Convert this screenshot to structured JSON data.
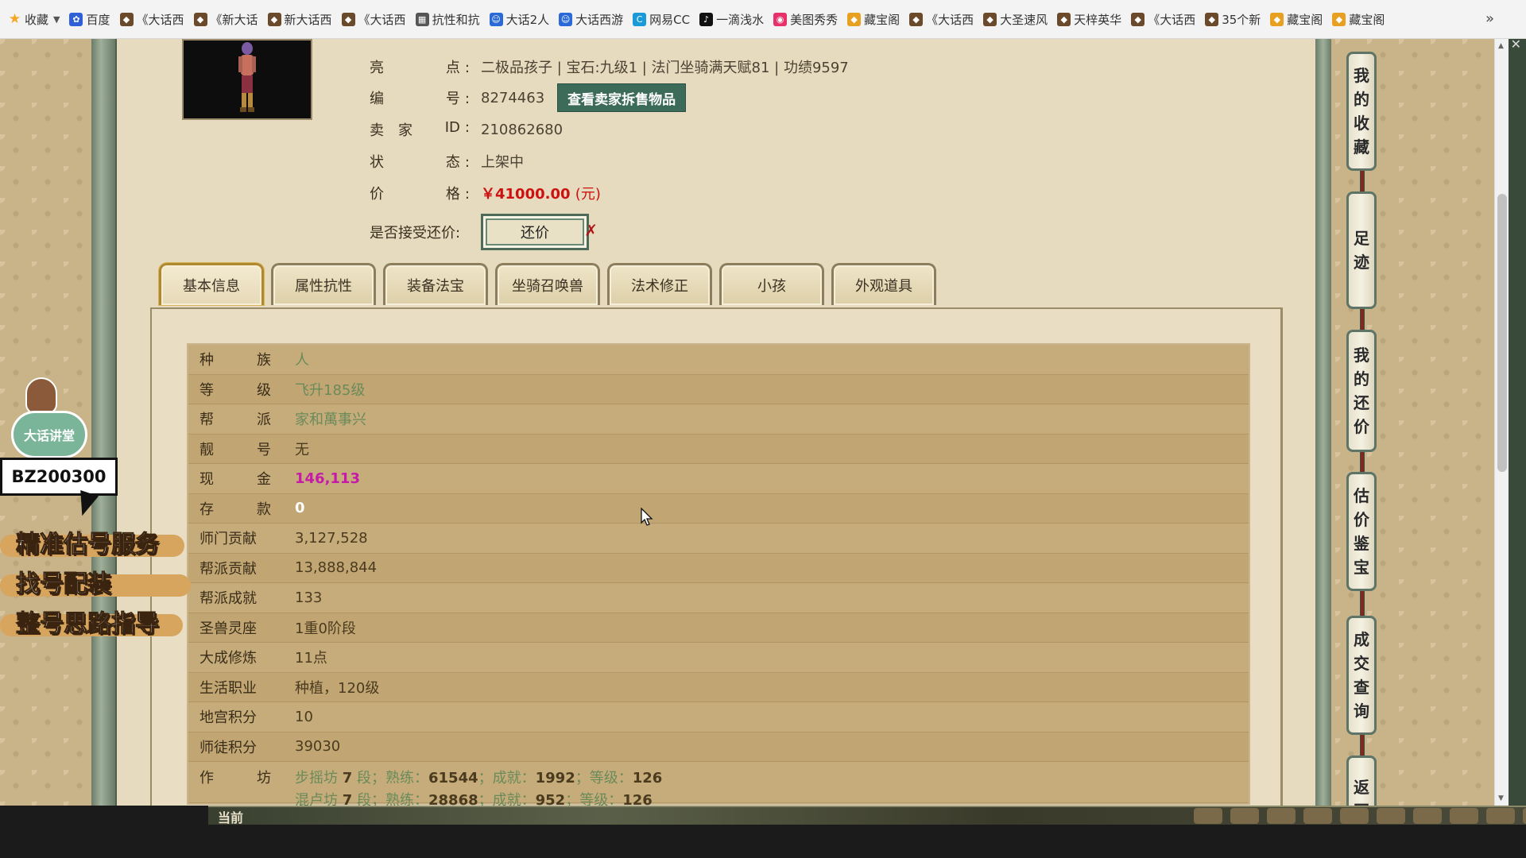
{
  "bookmarks": {
    "items": [
      {
        "label": "收藏",
        "icon": "star-icon",
        "color": "#f5a623",
        "dropdown": true
      },
      {
        "label": "百度",
        "icon": "baidu-icon",
        "color": "#3060d8"
      },
      {
        "label": "《大话西",
        "icon": "game-icon",
        "color": "#6a4a2a"
      },
      {
        "label": "《新大话",
        "icon": "game-icon",
        "color": "#6a4a2a"
      },
      {
        "label": "新大话西",
        "icon": "game-icon",
        "color": "#6a4a2a"
      },
      {
        "label": "《大话西",
        "icon": "game-icon",
        "color": "#6a4a2a"
      },
      {
        "label": "抗性和抗",
        "icon": "page-icon",
        "color": "#555555"
      },
      {
        "label": "大话2人",
        "icon": "mascot-icon",
        "color": "#2a6ad8"
      },
      {
        "label": "大话西游",
        "icon": "mascot-icon",
        "color": "#2a6ad8"
      },
      {
        "label": "网易CC",
        "icon": "cc-icon",
        "color": "#1a9ad8"
      },
      {
        "label": "一滴浅水",
        "icon": "tiktok-icon",
        "color": "#111111"
      },
      {
        "label": "美图秀秀",
        "icon": "meitu-icon",
        "color": "#e8306a"
      },
      {
        "label": "藏宝阁",
        "icon": "treasure-icon",
        "color": "#e8a020"
      },
      {
        "label": "《大话西",
        "icon": "game-icon",
        "color": "#6a4a2a"
      },
      {
        "label": "大圣速风",
        "icon": "game-icon",
        "color": "#6a4a2a"
      },
      {
        "label": "天梓英华",
        "icon": "game-icon",
        "color": "#6a4a2a"
      },
      {
        "label": "《大话西",
        "icon": "game-icon",
        "color": "#6a4a2a"
      },
      {
        "label": "35个新",
        "icon": "game-icon",
        "color": "#6a4a2a"
      },
      {
        "label": "藏宝阁",
        "icon": "treasure-icon",
        "color": "#e8a020"
      },
      {
        "label": "藏宝阁",
        "icon": "treasure-icon",
        "color": "#e8a020"
      }
    ],
    "more": "»"
  },
  "item_info": {
    "highlights_label": "亮",
    "highlights_label2": "点",
    "highlights": "二极品孩子 | 宝石:九级1 | 法门坐骑满天赋81 | 功绩9597",
    "id_label": "编",
    "id_label2": "号",
    "id_value": "8274463",
    "seller_button": "查看卖家拆售物品",
    "seller_label": "卖　家",
    "seller_label2": "ID",
    "seller_id": "210862680",
    "status_label": "状",
    "status_label2": "态",
    "status": "上架中",
    "price_label": "价",
    "price_label2": "格",
    "price": "￥41000.00",
    "price_unit": "(元)",
    "bargain_label": "是否接受还价:",
    "bargain_button": "还价",
    "bargain_mark": "✗"
  },
  "tabs": [
    "基本信息",
    "属性抗性",
    "装备法宝",
    "坐骑召唤兽",
    "法术修正",
    "小孩",
    "外观道具"
  ],
  "attributes": [
    {
      "label_a": "种",
      "label_b": "族",
      "value": "人",
      "style": "green"
    },
    {
      "label_a": "等",
      "label_b": "级",
      "value": "飞升185级",
      "style": "green"
    },
    {
      "label_a": "帮",
      "label_b": "派",
      "value": "家和萬事兴",
      "style": "green"
    },
    {
      "label_a": "靓",
      "label_b": "号",
      "value": "无",
      "style": "brown"
    },
    {
      "label_a": "现",
      "label_b": "金",
      "value": "146,113",
      "style": "magenta"
    },
    {
      "label_a": "存",
      "label_b": "款",
      "value": "0",
      "style": "white"
    },
    {
      "label_full": "师门贡献",
      "value": "3,127,528",
      "style": "brown"
    },
    {
      "label_full": "帮派贡献",
      "value": "13,888,844",
      "style": "brown"
    },
    {
      "label_full": "帮派成就",
      "value": "133",
      "style": "brown"
    },
    {
      "label_full": "圣兽灵座",
      "value": "1重0阶段",
      "style": "brown"
    },
    {
      "label_full": "大成修炼",
      "value": "11点",
      "style": "brown"
    },
    {
      "label_full": "生活职业",
      "value": "种植，120级",
      "style": "brown"
    },
    {
      "label_full": "地宫积分",
      "value": "10",
      "style": "brown"
    },
    {
      "label_full": "师徒积分",
      "value": "39030",
      "style": "brown"
    }
  ],
  "workshop": {
    "label_a": "作",
    "label_b": "坊",
    "lines": [
      {
        "name": "步摇坊",
        "level": "7",
        "unit": "段",
        "k1": "熟练",
        "v1": "61544",
        "k2": "成就",
        "v2": "1992",
        "k3": "等级",
        "v3": "126"
      },
      {
        "name": "混卢坊",
        "level": "7",
        "unit": "段",
        "k1": "熟练",
        "v1": "28868",
        "k2": "成就",
        "v2": "952",
        "k3": "等级",
        "v3": "126"
      }
    ]
  },
  "right_rail": [
    {
      "label": "我的收藏",
      "chars": [
        "我",
        "的",
        "收",
        "藏"
      ]
    },
    {
      "label": "足迹",
      "chars": [
        "足",
        "迹"
      ]
    },
    {
      "label": "我的还价",
      "chars": [
        "我",
        "的",
        "还",
        "价"
      ]
    },
    {
      "label": "估价鉴宝",
      "chars": [
        "估",
        "价",
        "鉴",
        "宝"
      ]
    },
    {
      "label": "成交查询",
      "chars": [
        "成",
        "交",
        "查",
        "询"
      ]
    },
    {
      "label": "返回",
      "chars": [
        "返",
        "回"
      ]
    }
  ],
  "overlay": {
    "badge": "大话讲堂",
    "code": "BZ200300",
    "promos": [
      "精准估号服务",
      "找号配装",
      "整号思路指导"
    ]
  },
  "game_bar": {
    "label": "当前"
  },
  "colors": {
    "accent_green": "#3d6b5a",
    "price_red": "#cc1111",
    "cash_magenta": "#c61aa8",
    "value_green": "#6a8a5a"
  }
}
